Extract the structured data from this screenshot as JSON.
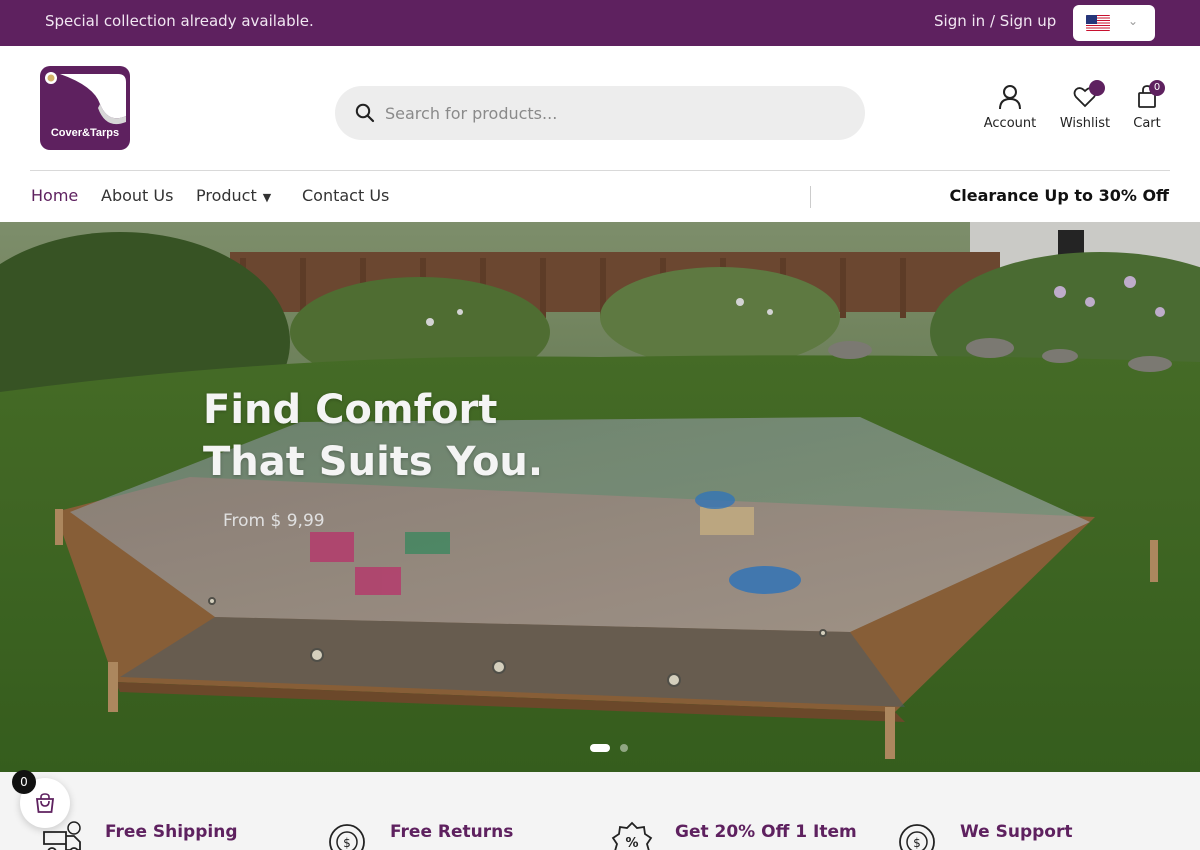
{
  "topbar": {
    "promo": "Special collection already available.",
    "sign_in": "Sign in",
    "separator": "/",
    "sign_up": "Sign up",
    "language_flag": "us-flag-icon"
  },
  "brand": {
    "logo_text": "Cover&Tarps"
  },
  "search": {
    "placeholder": "Search for products..."
  },
  "header_icons": {
    "account": "Account",
    "wishlist": "Wishlist",
    "cart": "Cart",
    "cart_count": "0"
  },
  "nav": {
    "items": [
      {
        "label": "Home",
        "active": true
      },
      {
        "label": "About Us"
      },
      {
        "label": "Product",
        "has_dropdown": true
      },
      {
        "label": "Contact Us"
      }
    ],
    "promo": "Clearance Up to 30% Off"
  },
  "hero": {
    "title_line1": "Find Comfort",
    "title_line2": "That Suits You.",
    "subtitle": "From $ 9,99",
    "slides": 2,
    "active_slide": 1
  },
  "features": [
    {
      "title": "Free Shipping",
      "icon": "delivery-truck-icon"
    },
    {
      "title": "Free Returns",
      "icon": "money-return-icon"
    },
    {
      "title": "Get 20% Off 1 Item",
      "icon": "discount-badge-icon"
    },
    {
      "title": "We Support",
      "icon": "support-money-icon"
    }
  ],
  "floating_cart": {
    "count": "0"
  },
  "colors": {
    "brand": "#5e215f",
    "topbar_text": "#f1e6f2"
  }
}
